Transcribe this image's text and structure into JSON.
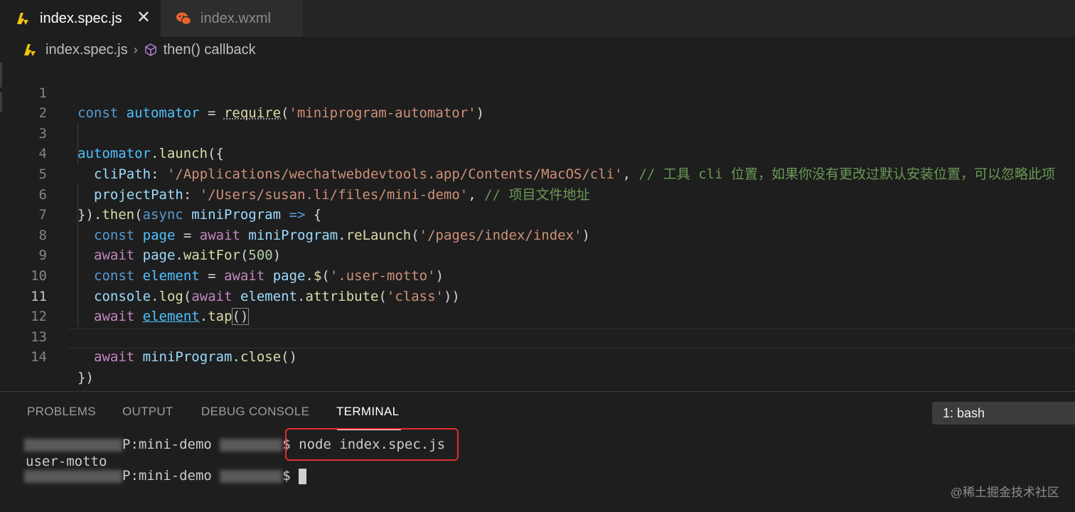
{
  "tabs": [
    {
      "label": "index.spec.js",
      "icon": "javascript-icon",
      "active": true,
      "close": "✕"
    },
    {
      "label": "index.wxml",
      "icon": "wechat-icon",
      "active": false
    }
  ],
  "breadcrumb": {
    "file": "index.spec.js",
    "separator": "›",
    "symbol": "then() callback"
  },
  "editor": {
    "current_line": 11,
    "line_numbers": [
      "1",
      "2",
      "3",
      "4",
      "5",
      "6",
      "7",
      "8",
      "9",
      "10",
      "11",
      "12",
      "13",
      "14"
    ],
    "l1": {
      "a": "const",
      "b": " ",
      "c": "automator",
      "d": " = ",
      "e": "require",
      "f": "(",
      "g": "'miniprogram-automator'",
      "h": ")"
    },
    "l3": {
      "a": "automator",
      "b": ".",
      "c": "launch",
      "d": "({"
    },
    "l4": {
      "a": "cliPath",
      "b": ": ",
      "c": "'/Applications/wechatwebdevtools.app/Contents/MacOS/cli'",
      "d": ", ",
      "e": "// 工具 cli 位置，如果你没有更改过默认安装位置，可以忽略此项"
    },
    "l5": {
      "a": "projectPath",
      "b": ": ",
      "c": "'/Users/susan.li/files/mini-demo'",
      "d": ", ",
      "e": "// 项目文件地址"
    },
    "l6": {
      "a": "}).",
      "b": "then",
      "c": "(",
      "d": "async",
      "e": " ",
      "f": "miniProgram",
      "g": " ",
      "h": "=>",
      "i": " {"
    },
    "l7": {
      "a": "const",
      "b": " ",
      "c": "page",
      "d": " = ",
      "e": "await",
      "f": " ",
      "g": "miniProgram",
      "h": ".",
      "i": "reLaunch",
      "j": "(",
      "k": "'/pages/index/index'",
      "l": ")"
    },
    "l8": {
      "a": "await",
      "b": " ",
      "c": "page",
      "d": ".",
      "e": "waitFor",
      "f": "(",
      "g": "500",
      "h": ")"
    },
    "l9": {
      "a": "const",
      "b": " ",
      "c": "element",
      "d": " = ",
      "e": "await",
      "f": " ",
      "g": "page",
      "h": ".",
      "i": "$",
      "j": "(",
      "k": "'.user-motto'",
      "l": ")"
    },
    "l10": {
      "a": "console",
      "b": ".",
      "c": "log",
      "d": "(",
      "e": "await",
      "f": " ",
      "g": "element",
      "h": ".",
      "i": "attribute",
      "j": "(",
      "k": "'class'",
      "l": "))"
    },
    "l11": {
      "a": "await",
      "b": " ",
      "c": "element",
      "d": ".",
      "e": "tap",
      "f": "()"
    },
    "l13": {
      "a": "await",
      "b": " ",
      "c": "miniProgram",
      "d": ".",
      "e": "close",
      "f": "()"
    },
    "l14": {
      "a": "})"
    }
  },
  "panel": {
    "tabs": [
      "PROBLEMS",
      "OUTPUT",
      "DEBUG CONSOLE",
      "TERMINAL"
    ],
    "active_tab": "TERMINAL",
    "terminal_select": "1: bash",
    "terminal": {
      "line1_prefix": "P:mini-demo ",
      "line1_suffix": "$ ",
      "line1_command": "node index.spec.js",
      "line2": "user-motto",
      "line3_prefix": "P:mini-demo ",
      "line3_suffix": "$ "
    }
  },
  "watermark": "@稀土掘金技术社区",
  "colors": {
    "background": "#1e1e1e",
    "keyword": "#569cd6",
    "string": "#ce9178",
    "comment": "#6a9955",
    "function": "#dcdcaa",
    "highlight_box": "#e02e2e"
  }
}
